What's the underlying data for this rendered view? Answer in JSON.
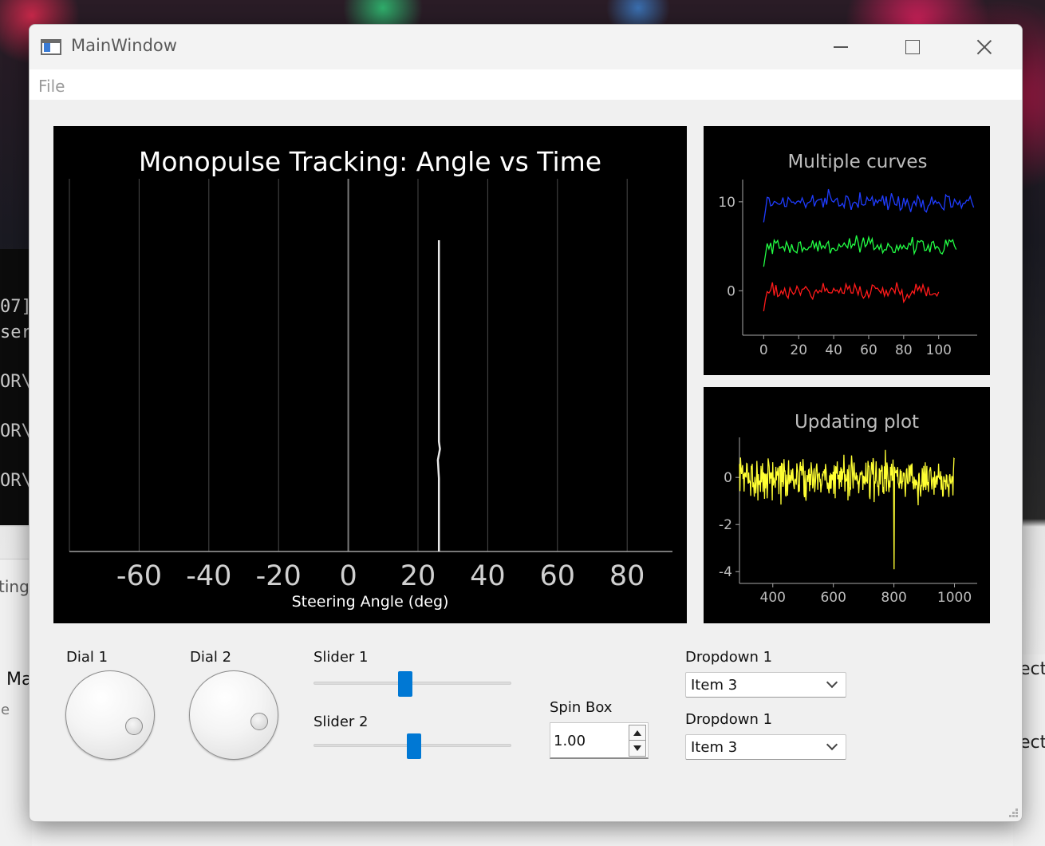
{
  "window": {
    "title": "MainWindow"
  },
  "menu": {
    "file": "File"
  },
  "background": {
    "terminal_lines": [
      "07]",
      "ser",
      "OR\\",
      "OR\\",
      "OR\\"
    ],
    "left_window_texts": [
      "ting",
      "Ma",
      "le"
    ],
    "right_window_texts": [
      "ect",
      "ect"
    ]
  },
  "colors": {
    "plot_bg": "#000000",
    "curve_blue": "#1f3cff",
    "curve_green": "#22ff44",
    "curve_red": "#ff1a1a",
    "update_yellow": "#ffff33",
    "trace_white": "#e8e8e8",
    "accent": "#0078d4"
  },
  "chart_data": [
    {
      "type": "line",
      "title": "Monopulse Tracking: Angle vs Time",
      "xlabel": "Steering Angle (deg)",
      "ylabel": "",
      "xlim": [
        -80,
        93
      ],
      "xticks": [
        -60,
        -40,
        -20,
        0,
        20,
        40,
        60,
        80
      ],
      "tick_labels": [
        "-60",
        "-40",
        "-20",
        "0",
        "20",
        "40",
        "60",
        "80"
      ],
      "grid": true,
      "series": [
        {
          "color": "#e8e8e8",
          "x": [
            26.0,
            26.0,
            25.7,
            26.3,
            26.0,
            26.0
          ],
          "y": [
            0.0,
            0.2,
            0.25,
            0.28,
            0.3,
            0.85
          ]
        }
      ]
    },
    {
      "type": "line",
      "title": "Multiple curves",
      "xlim": [
        -12,
        122
      ],
      "ylim": [
        -5,
        12.5
      ],
      "xticks": [
        0,
        20,
        40,
        60,
        80,
        100
      ],
      "xtick_labels": [
        "0",
        "20",
        "40",
        "60",
        "80",
        "100"
      ],
      "yticks": [
        0,
        10
      ],
      "ytick_labels": [
        "0",
        "10"
      ],
      "series": [
        {
          "color": "#1f3cff",
          "n_points": 121,
          "offset": 10,
          "approx_range": [
            8.5,
            12
          ]
        },
        {
          "color": "#22ff44",
          "n_points": 111,
          "offset": 5,
          "approx_range": [
            2.5,
            7
          ]
        },
        {
          "color": "#ff1a1a",
          "n_points": 101,
          "offset": 0,
          "approx_range": [
            -3,
            2.5
          ]
        }
      ]
    },
    {
      "type": "line",
      "title": "Updating plot",
      "xlim": [
        290,
        1075
      ],
      "ylim": [
        -4.5,
        1.7
      ],
      "xticks": [
        400,
        600,
        800,
        1000
      ],
      "xtick_labels": [
        "400",
        "600",
        "800",
        "1000"
      ],
      "yticks": [
        0,
        -2,
        -4
      ],
      "ytick_labels": [
        "0",
        "-2",
        "-4"
      ],
      "series": [
        {
          "color": "#ffff33",
          "x_range": [
            290,
            1000
          ],
          "approx_range": [
            -3.9,
            1.7
          ]
        }
      ]
    }
  ],
  "controls": {
    "dial1": {
      "label": "Dial 1",
      "value_fraction": 0.88
    },
    "dial2": {
      "label": "Dial 2",
      "value_fraction": 0.84
    },
    "slider1": {
      "label": "Slider 1",
      "value_fraction": 0.46
    },
    "slider2": {
      "label": "Slider 2",
      "value_fraction": 0.51
    },
    "spinbox": {
      "label": "Spin Box",
      "value": "1.00"
    },
    "dropdown1": {
      "label": "Dropdown 1",
      "value": "Item 3"
    },
    "dropdown2": {
      "label": "Dropdown 1",
      "value": "Item 3"
    }
  }
}
